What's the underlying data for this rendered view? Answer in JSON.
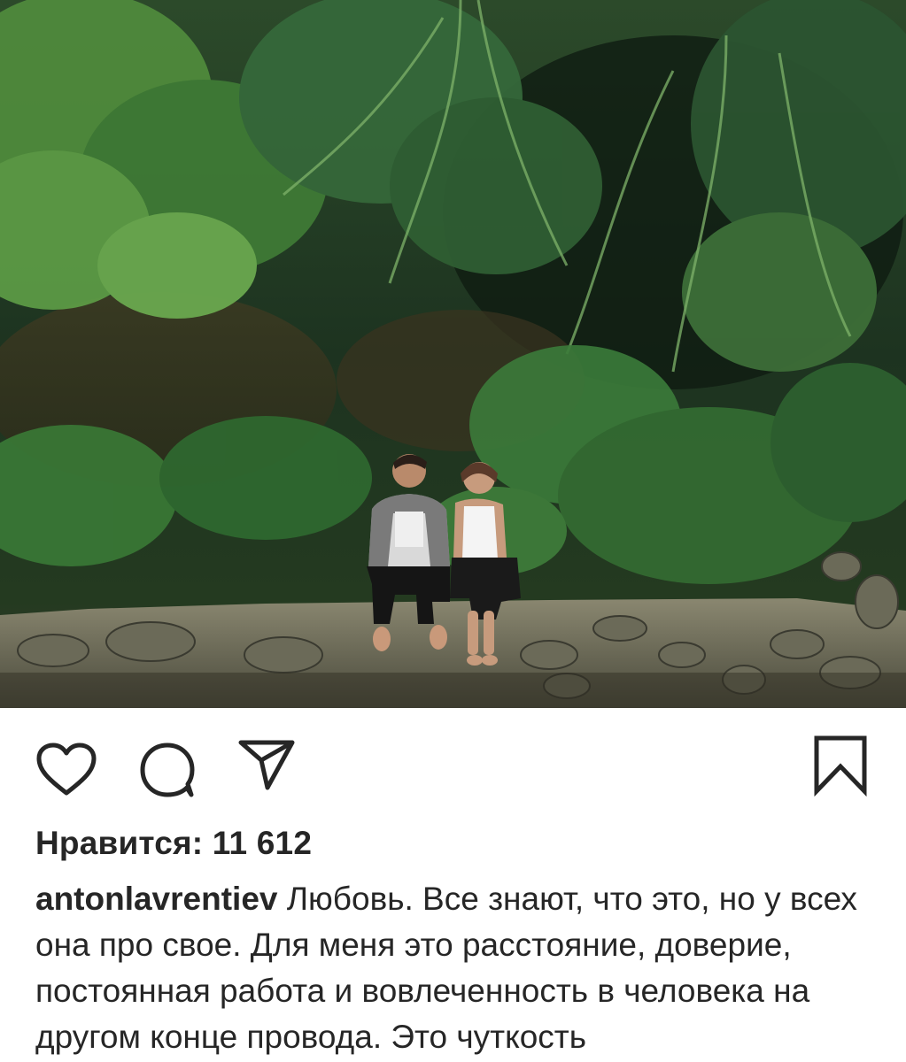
{
  "post": {
    "image_alt": "Couple sitting on a stone wall in a jungle",
    "likes_text": "Нравится: 11 612",
    "caption_username": "antonlavrentiev",
    "caption_text": " Любовь. Все знают, что это, но у всех она про свое. Для меня это расстояние, доверие, постоянная работа и вовлеченность в человека на другом конце провода. Это чуткость"
  },
  "icons": {
    "like": "heart-icon",
    "comment": "comment-bubble-icon",
    "share": "paper-plane-icon",
    "save": "bookmark-icon"
  },
  "colors": {
    "text": "#262626",
    "background": "#ffffff",
    "foliage_dark": "#1f3a22",
    "foliage_light": "#4f8a3c"
  }
}
